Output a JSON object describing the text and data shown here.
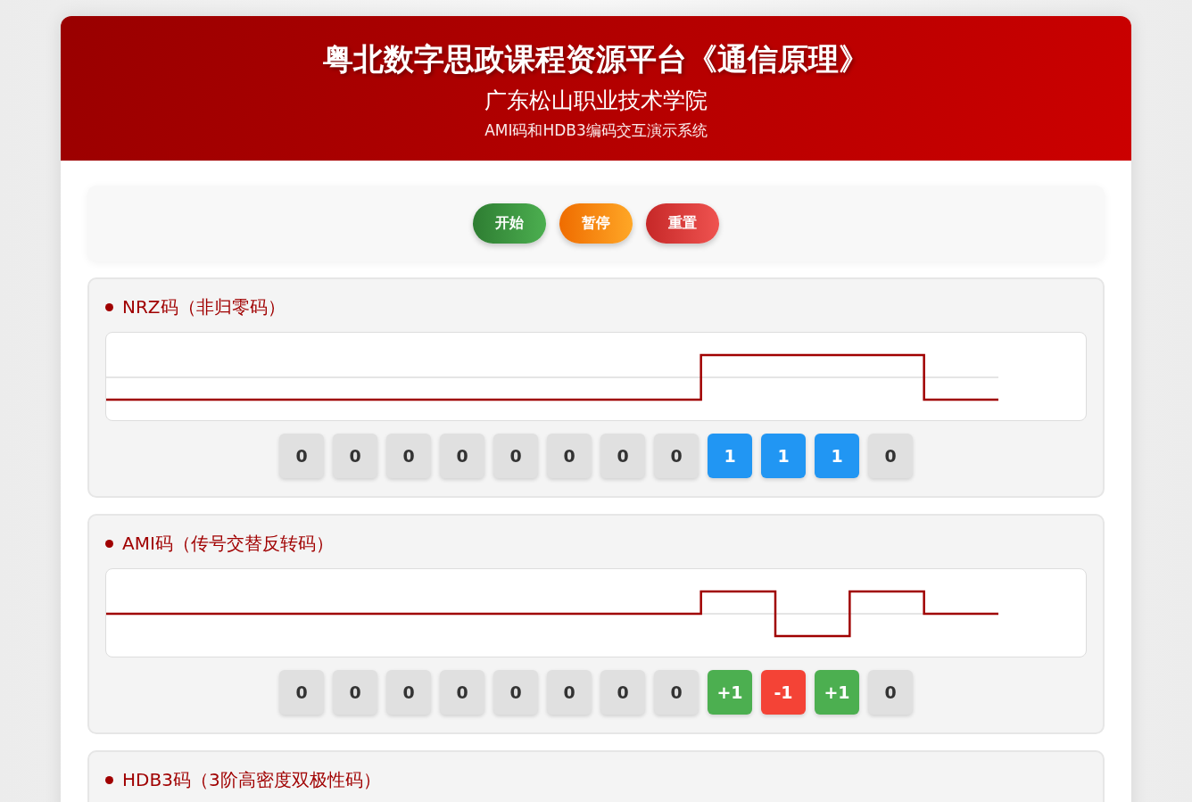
{
  "header": {
    "title": "粤北数字思政课程资源平台《通信原理》",
    "subtitle": "广东松山职业技术学院",
    "caption": "AMI码和HDB3编码交互演示系统"
  },
  "controls": [
    {
      "label": "开始",
      "kind": "start"
    },
    {
      "label": "暂停",
      "kind": "pause"
    },
    {
      "label": "重置",
      "kind": "reset"
    }
  ],
  "panels": [
    {
      "title": "NRZ码（非归零码）",
      "kind": "unipolar",
      "bits": [
        {
          "label": "0",
          "kind": "zero"
        },
        {
          "label": "0",
          "kind": "zero"
        },
        {
          "label": "0",
          "kind": "zero"
        },
        {
          "label": "0",
          "kind": "zero"
        },
        {
          "label": "0",
          "kind": "zero"
        },
        {
          "label": "0",
          "kind": "zero"
        },
        {
          "label": "0",
          "kind": "zero"
        },
        {
          "label": "0",
          "kind": "zero"
        },
        {
          "label": "1",
          "kind": "one"
        },
        {
          "label": "1",
          "kind": "one"
        },
        {
          "label": "1",
          "kind": "one"
        },
        {
          "label": "0",
          "kind": "zero"
        }
      ]
    },
    {
      "title": "AMI码（传号交替反转码）",
      "kind": "bipolar",
      "bits": [
        {
          "label": "0",
          "kind": "zero"
        },
        {
          "label": "0",
          "kind": "zero"
        },
        {
          "label": "0",
          "kind": "zero"
        },
        {
          "label": "0",
          "kind": "zero"
        },
        {
          "label": "0",
          "kind": "zero"
        },
        {
          "label": "0",
          "kind": "zero"
        },
        {
          "label": "0",
          "kind": "zero"
        },
        {
          "label": "0",
          "kind": "zero"
        },
        {
          "label": "+1",
          "kind": "plus"
        },
        {
          "label": "-1",
          "kind": "minus"
        },
        {
          "label": "+1",
          "kind": "plus"
        },
        {
          "label": "0",
          "kind": "zero"
        }
      ]
    },
    {
      "title": "HDB3码（3阶高密度双极性码）"
    }
  ]
}
